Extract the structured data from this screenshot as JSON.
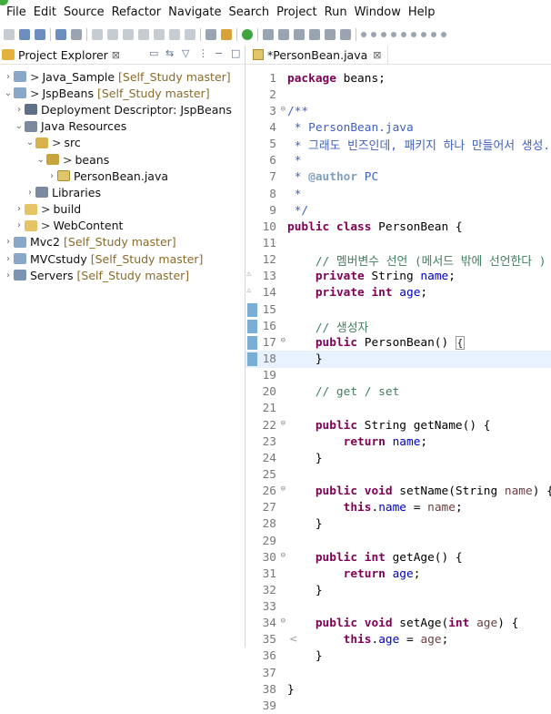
{
  "menu": [
    "File",
    "Edit",
    "Source",
    "Refactor",
    "Navigate",
    "Search",
    "Project",
    "Run",
    "Window",
    "Help"
  ],
  "explorer": {
    "title": "Project Explorer",
    "close_glyph": "⊠",
    "tree": [
      {
        "level": 0,
        "arrow": "›",
        "icon": "project",
        "prefix": "> ",
        "label": "Java_Sample",
        "repo": "[Self_Study master]"
      },
      {
        "level": 0,
        "arrow": "⌄",
        "icon": "project",
        "prefix": "> ",
        "label": "JspBeans",
        "repo": "[Self_Study master]"
      },
      {
        "level": 1,
        "arrow": "›",
        "icon": "desc",
        "prefix": "",
        "label": "Deployment Descriptor: JspBeans",
        "repo": ""
      },
      {
        "level": 1,
        "arrow": "⌄",
        "icon": "lib",
        "prefix": "",
        "label": "Java Resources",
        "repo": ""
      },
      {
        "level": 2,
        "arrow": "⌄",
        "icon": "src",
        "prefix": "> ",
        "label": "src",
        "repo": ""
      },
      {
        "level": 3,
        "arrow": "⌄",
        "icon": "pkg",
        "prefix": "> ",
        "label": "beans",
        "repo": ""
      },
      {
        "level": 4,
        "arrow": "›",
        "icon": "java",
        "prefix": "",
        "label": "PersonBean.java",
        "repo": ""
      },
      {
        "level": 2,
        "arrow": "›",
        "icon": "lib",
        "prefix": "",
        "label": "Libraries",
        "repo": ""
      },
      {
        "level": 1,
        "arrow": "›",
        "icon": "folder",
        "prefix": "> ",
        "label": "build",
        "repo": ""
      },
      {
        "level": 1,
        "arrow": "›",
        "icon": "folder",
        "prefix": "> ",
        "label": "WebContent",
        "repo": ""
      },
      {
        "level": 0,
        "arrow": "›",
        "icon": "project",
        "prefix": "",
        "label": "Mvc2",
        "repo": "[Self_Study master]"
      },
      {
        "level": 0,
        "arrow": "›",
        "icon": "project",
        "prefix": "",
        "label": "MVCstudy",
        "repo": "[Self_Study master]"
      },
      {
        "level": 0,
        "arrow": "›",
        "icon": "server",
        "prefix": "",
        "label": "Servers",
        "repo": "[Self_Study master]"
      }
    ]
  },
  "editor": {
    "tab_label": "*PersonBean.java",
    "tab_close": "⊠",
    "lines": [
      {
        "n": "1",
        "tokens": [
          [
            "kw",
            "package"
          ],
          [
            "pl",
            " beans;"
          ]
        ]
      },
      {
        "n": "2",
        "tokens": []
      },
      {
        "n": "3",
        "fold": "⊖",
        "tokens": [
          [
            "jd",
            "/**"
          ]
        ]
      },
      {
        "n": "4",
        "tokens": [
          [
            "jd",
            " * PersonBean.java"
          ]
        ]
      },
      {
        "n": "5",
        "tokens": [
          [
            "jd",
            " * 그래도 빈즈인데, 패키지 하나 만들어서 생성.."
          ]
        ]
      },
      {
        "n": "6",
        "tokens": [
          [
            "jd",
            " *"
          ]
        ]
      },
      {
        "n": "7",
        "tokens": [
          [
            "jd",
            " * "
          ],
          [
            "jt",
            "@author"
          ],
          [
            "jd",
            " PC"
          ]
        ]
      },
      {
        "n": "8",
        "tokens": [
          [
            "jd",
            " *"
          ]
        ]
      },
      {
        "n": "9",
        "tokens": [
          [
            "jd",
            " */"
          ]
        ]
      },
      {
        "n": "10",
        "tokens": [
          [
            "kw",
            "public class"
          ],
          [
            "pl",
            " PersonBean {"
          ]
        ]
      },
      {
        "n": "11",
        "tokens": []
      },
      {
        "n": "12",
        "tokens": [
          [
            "cm",
            "    // 멤버변수 선언 (메서드 밖에 선언한다 )"
          ]
        ]
      },
      {
        "n": "13",
        "mark": "⚠",
        "tokens": [
          [
            "pl",
            "    "
          ],
          [
            "kw",
            "private"
          ],
          [
            "pl",
            " String "
          ],
          [
            "fld",
            "name"
          ],
          [
            "pl",
            ";"
          ]
        ]
      },
      {
        "n": "14",
        "mark": "⚠",
        "tokens": [
          [
            "pl",
            "    "
          ],
          [
            "kw",
            "private int"
          ],
          [
            "pl",
            " "
          ],
          [
            "fld",
            "age"
          ],
          [
            "pl",
            ";"
          ]
        ]
      },
      {
        "n": "15",
        "changed": true,
        "tokens": []
      },
      {
        "n": "16",
        "changed": true,
        "tokens": [
          [
            "cm",
            "    // 생성자"
          ]
        ]
      },
      {
        "n": "17",
        "changed": true,
        "fold": "⊖",
        "tokens": [
          [
            "pl",
            "    "
          ],
          [
            "kw",
            "public"
          ],
          [
            "pl",
            " PersonBean() "
          ],
          [
            "box",
            "{"
          ]
        ]
      },
      {
        "n": "18",
        "changed": true,
        "current": true,
        "tokens": [
          [
            "pl",
            "    }"
          ]
        ]
      },
      {
        "n": "19",
        "tokens": []
      },
      {
        "n": "20",
        "tokens": [
          [
            "cm",
            "    // get / set"
          ]
        ]
      },
      {
        "n": "21",
        "tokens": []
      },
      {
        "n": "22",
        "fold": "⊖",
        "tokens": [
          [
            "pl",
            "    "
          ],
          [
            "kw",
            "public"
          ],
          [
            "pl",
            " String getName() {"
          ]
        ]
      },
      {
        "n": "23",
        "tokens": [
          [
            "pl",
            "        "
          ],
          [
            "kw",
            "return"
          ],
          [
            "pl",
            " "
          ],
          [
            "fld",
            "name"
          ],
          [
            "pl",
            ";"
          ]
        ]
      },
      {
        "n": "24",
        "tokens": [
          [
            "pl",
            "    }"
          ]
        ]
      },
      {
        "n": "25",
        "tokens": []
      },
      {
        "n": "26",
        "fold": "⊖",
        "tokens": [
          [
            "pl",
            "    "
          ],
          [
            "kw",
            "public void"
          ],
          [
            "pl",
            " setName(String "
          ],
          [
            "prm",
            "name"
          ],
          [
            "pl",
            ") {"
          ]
        ]
      },
      {
        "n": "27",
        "tokens": [
          [
            "pl",
            "        "
          ],
          [
            "kw",
            "this"
          ],
          [
            "pl",
            "."
          ],
          [
            "fld",
            "name"
          ],
          [
            "pl",
            " = "
          ],
          [
            "prm",
            "name"
          ],
          [
            "pl",
            ";"
          ]
        ]
      },
      {
        "n": "28",
        "tokens": [
          [
            "pl",
            "    }"
          ]
        ]
      },
      {
        "n": "29",
        "tokens": []
      },
      {
        "n": "30",
        "fold": "⊖",
        "tokens": [
          [
            "pl",
            "    "
          ],
          [
            "kw",
            "public int"
          ],
          [
            "pl",
            " getAge() {"
          ]
        ]
      },
      {
        "n": "31",
        "tokens": [
          [
            "pl",
            "        "
          ],
          [
            "kw",
            "return"
          ],
          [
            "pl",
            " "
          ],
          [
            "fld",
            "age"
          ],
          [
            "pl",
            ";"
          ]
        ]
      },
      {
        "n": "32",
        "tokens": [
          [
            "pl",
            "    }"
          ]
        ]
      },
      {
        "n": "33",
        "tokens": []
      },
      {
        "n": "34",
        "fold": "⊖",
        "tokens": [
          [
            "pl",
            "    "
          ],
          [
            "kw",
            "public void"
          ],
          [
            "pl",
            " setAge("
          ],
          [
            "kw",
            "int"
          ],
          [
            "pl",
            " "
          ],
          [
            "prm",
            "age"
          ],
          [
            "pl",
            ") {"
          ]
        ]
      },
      {
        "n": "35",
        "tokens": [
          [
            "pl",
            "        "
          ],
          [
            "kw",
            "this"
          ],
          [
            "pl",
            "."
          ],
          [
            "fld",
            "age"
          ],
          [
            "pl",
            " = "
          ],
          [
            "prm",
            "age"
          ],
          [
            "pl",
            ";"
          ]
        ]
      },
      {
        "n": "36",
        "tokens": [
          [
            "pl",
            "    }"
          ]
        ]
      },
      {
        "n": "37",
        "tokens": []
      },
      {
        "n": "38",
        "tokens": [
          [
            "pl",
            "}"
          ]
        ]
      },
      {
        "n": "39",
        "tokens": []
      }
    ],
    "scroll_glyph": "<"
  }
}
